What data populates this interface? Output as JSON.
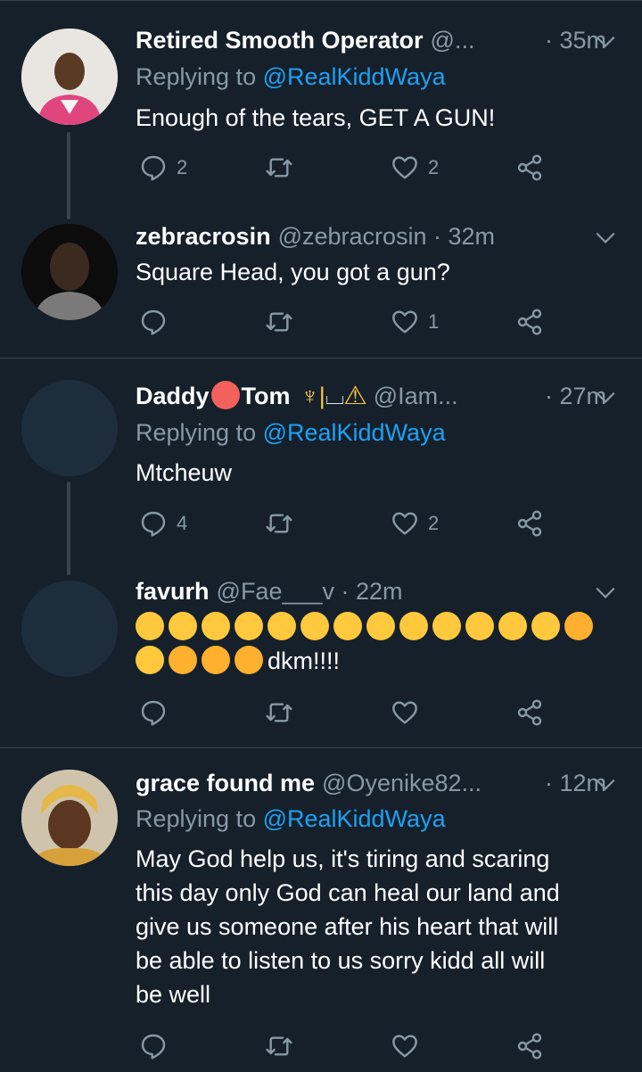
{
  "colors": {
    "background": "#15202b",
    "text": "#ffffff",
    "secondary": "#8899a6",
    "accent": "#1da1f2",
    "divider": "#38444d"
  },
  "tweets": [
    {
      "name": "Retired Smooth Operator",
      "handle": "@...",
      "time": "· 35m",
      "replying_prefix": "Replying to ",
      "replying_to": "@RealKiddWaya",
      "text": "Enough of the tears, GET A GUN!",
      "replies": "2",
      "retweets": "",
      "likes": "2"
    },
    {
      "name": "zebracrosin",
      "handle": "@zebracrosin · 32m",
      "time": "",
      "text": "Square Head, you got a gun?",
      "replies": "",
      "retweets": "",
      "likes": "1"
    },
    {
      "name": "Daddy",
      "name_mid": "Tom",
      "handle": "@Iam...",
      "time": "· 27m",
      "replying_prefix": "Replying to ",
      "replying_to": "@RealKiddWaya",
      "text": "Mtcheuw",
      "replies": "4",
      "retweets": "",
      "likes": "2"
    },
    {
      "name": "favurh",
      "handle": "@Fae___v · 22m",
      "time": "",
      "text_suffix": "dkm!!!!",
      "replies": "",
      "retweets": "",
      "likes": ""
    },
    {
      "name": "grace found me",
      "handle": "@Oyenike82...",
      "time": "· 12m",
      "replying_prefix": "Replying to ",
      "replying_to": "@RealKiddWaya",
      "text_lines": [
        "May God help us, it's tiring and scaring",
        "this day only God can heal our land and",
        "give us someone after his heart that will",
        "be able to listen to us sorry kidd all will",
        "be well"
      ],
      "replies": "",
      "retweets": "",
      "likes": ""
    }
  ],
  "icons": [
    "reply-icon",
    "retweet-icon",
    "like-icon",
    "share-icon",
    "chevron-down-icon"
  ]
}
